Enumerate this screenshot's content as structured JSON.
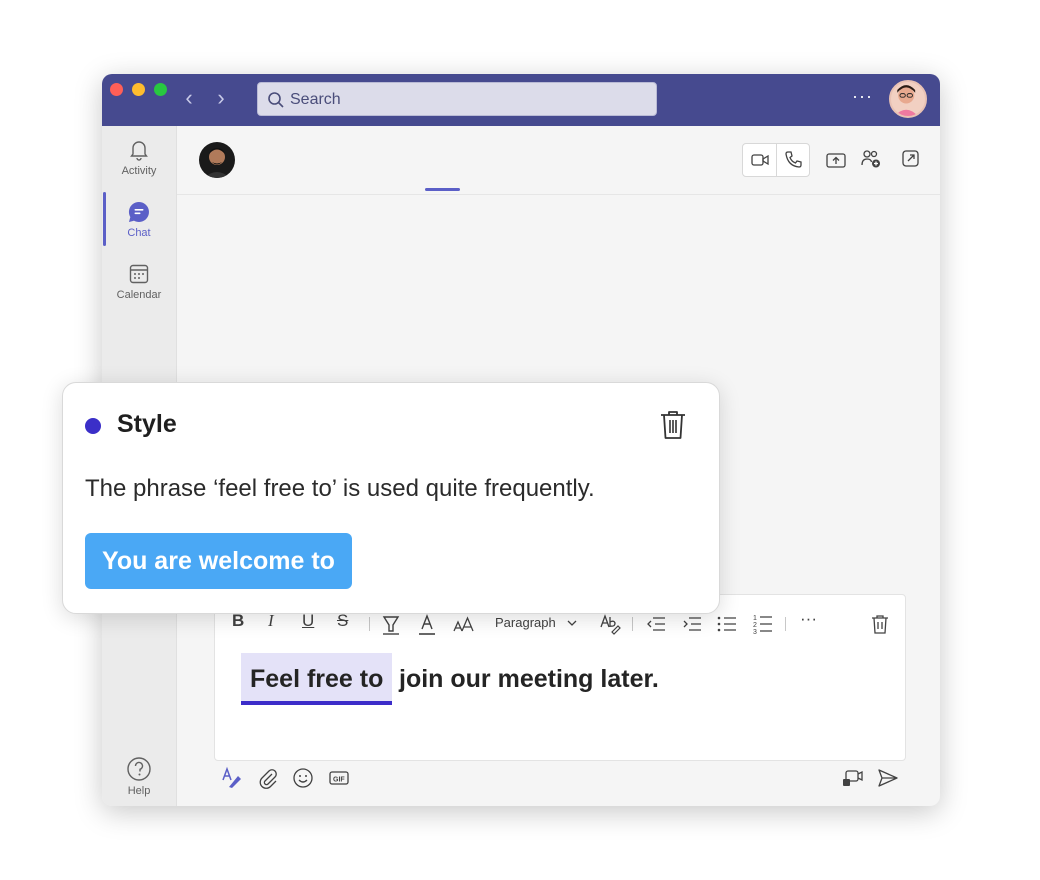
{
  "search": {
    "placeholder": "Search"
  },
  "titlebar": {
    "more": "···"
  },
  "rail": {
    "activity": "Activity",
    "chat": "Chat",
    "calendar": "Calendar",
    "help": "Help"
  },
  "toolbar": {
    "paragraph": "Paragraph",
    "more": "···"
  },
  "compose": {
    "highlight": "Feel free to",
    "rest": "join our meeting later."
  },
  "card": {
    "category": "Style",
    "message": "The phrase ‘feel free to’ is used quite frequently.",
    "suggestion": "You are welcome to"
  },
  "colors": {
    "titlebar": "#464a8f",
    "accent": "#5b5fc7",
    "dot": "#3b2fc8",
    "suggestion": "#4aa8f5",
    "highlight": "#e4e2f8"
  }
}
